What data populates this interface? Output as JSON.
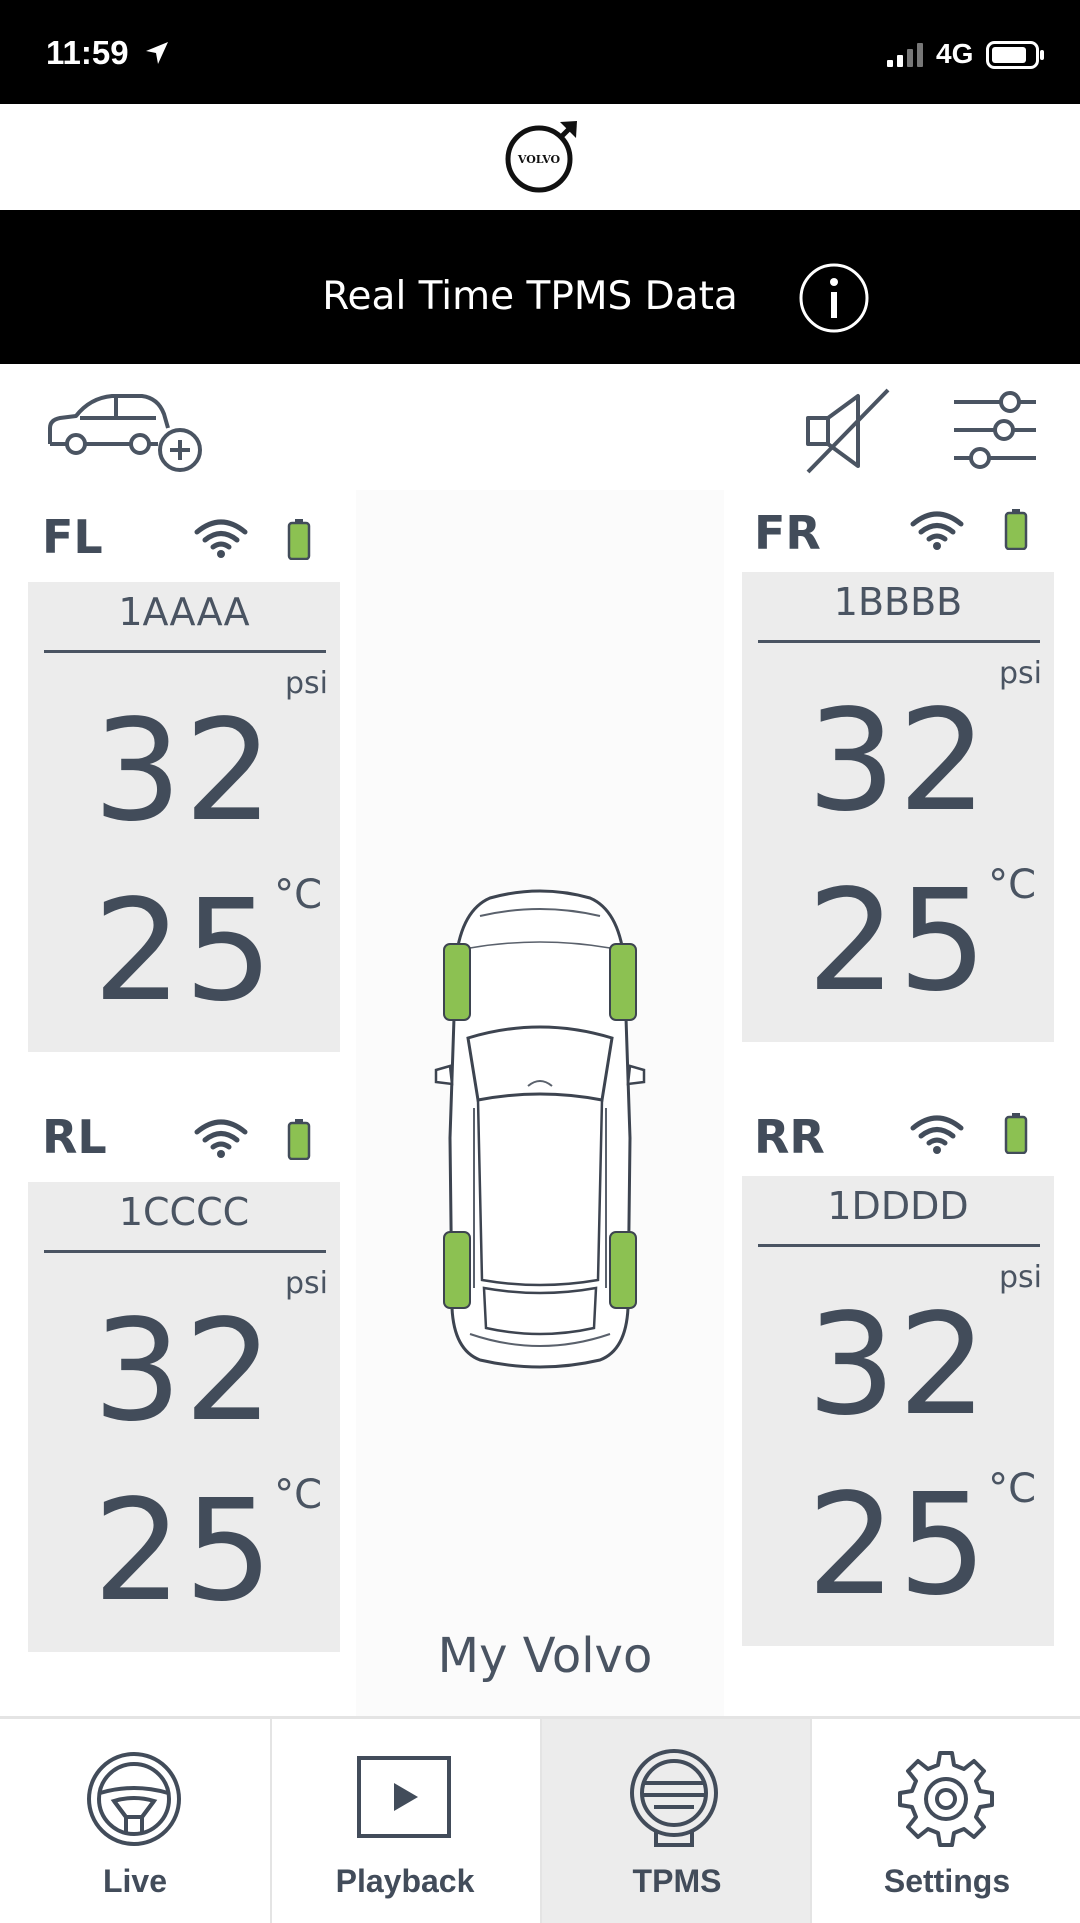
{
  "status_bar": {
    "time": "11:59",
    "network": "4G"
  },
  "header": {
    "title": "Real Time TPMS Data"
  },
  "logo": {
    "text": "VOLVO"
  },
  "tires": {
    "fl": {
      "position": "FL",
      "sensor_id": "1AAAA",
      "pressure": "32",
      "pressure_unit": "psi",
      "temperature": "25",
      "temperature_unit": "°C"
    },
    "fr": {
      "position": "FR",
      "sensor_id": "1BBBB",
      "pressure": "32",
      "pressure_unit": "psi",
      "temperature": "25",
      "temperature_unit": "°C"
    },
    "rl": {
      "position": "RL",
      "sensor_id": "1CCCC",
      "pressure": "32",
      "pressure_unit": "psi",
      "temperature": "25",
      "temperature_unit": "°C"
    },
    "rr": {
      "position": "RR",
      "sensor_id": "1DDDD",
      "pressure": "32",
      "pressure_unit": "psi",
      "temperature": "25",
      "temperature_unit": "°C"
    }
  },
  "vehicle": {
    "name": "My Volvo"
  },
  "nav": {
    "items": [
      {
        "label": "Live",
        "icon": "steering-wheel-icon"
      },
      {
        "label": "Playback",
        "icon": "play-icon"
      },
      {
        "label": "TPMS",
        "icon": "tire-icon",
        "active": true
      },
      {
        "label": "Settings",
        "icon": "gear-icon"
      }
    ]
  },
  "colors": {
    "tire_ok": "#8cc152",
    "text": "#4a5462",
    "panel": "#ececec",
    "header": "#000000"
  }
}
